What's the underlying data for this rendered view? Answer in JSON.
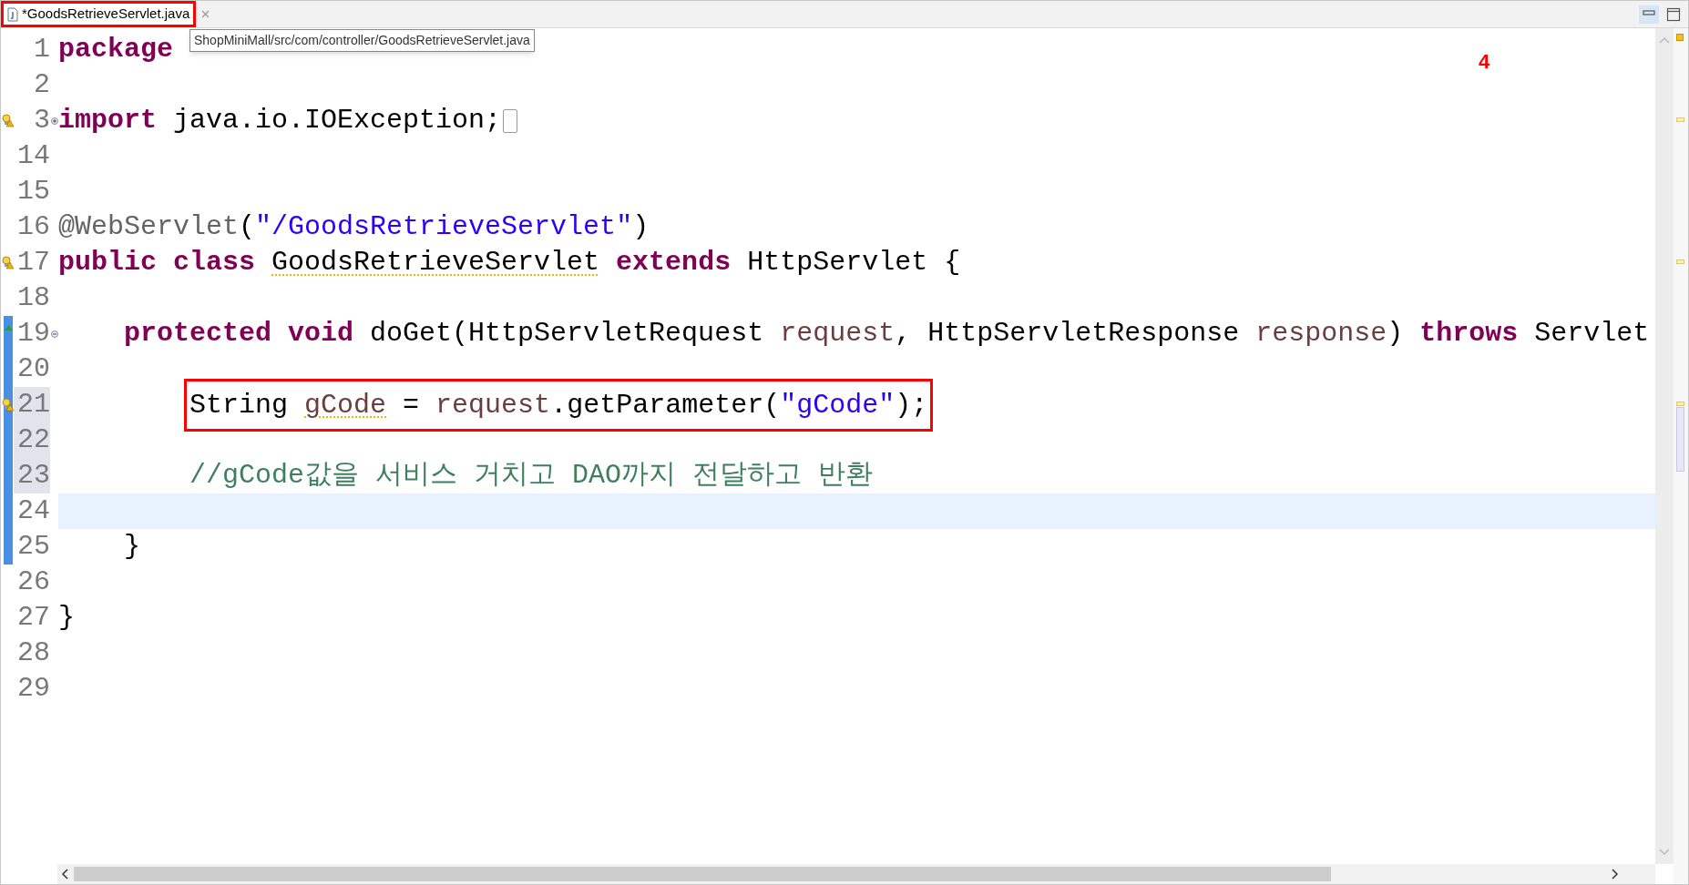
{
  "tab": {
    "title": "*GoodsRetrieveServlet.java",
    "selected": true,
    "boxed": true
  },
  "tooltip": "ShopMiniMall/src/com/controller/GoodsRetrieveServlet.java",
  "annotation": "4",
  "lines": [
    {
      "number": "1",
      "current": false,
      "in_range": false,
      "number_selected": false,
      "boxed": false,
      "warning": false,
      "tokens": [
        {
          "kind": "keyword",
          "text": "package"
        }
      ]
    },
    {
      "number": "2",
      "current": false,
      "in_range": false,
      "number_selected": false,
      "boxed": false,
      "warning": false
    },
    {
      "number": "3",
      "current": false,
      "in_range": false,
      "number_selected": false,
      "boxed": false,
      "warning": true,
      "collapsed": true,
      "tokens": [
        {
          "kind": "keyword",
          "text": "import"
        },
        {
          "kind": "plain",
          "text": " java.io.IOException;"
        }
      ]
    },
    {
      "number": "14",
      "current": false,
      "in_range": false,
      "number_selected": false,
      "boxed": false,
      "warning": false
    },
    {
      "number": "15",
      "current": false,
      "in_range": false,
      "number_selected": false,
      "boxed": false,
      "warning": false
    },
    {
      "number": "16",
      "current": false,
      "in_range": false,
      "number_selected": false,
      "boxed": false,
      "warning": false,
      "tokens": [
        {
          "kind": "annotation",
          "text": "@WebServlet"
        },
        {
          "kind": "plain",
          "text": "("
        },
        {
          "kind": "string",
          "text": "\"/GoodsRetrieveServlet\""
        },
        {
          "kind": "plain",
          "text": ")"
        }
      ]
    },
    {
      "number": "17",
      "current": false,
      "in_range": false,
      "number_selected": false,
      "boxed": false,
      "warning": true,
      "tokens": [
        {
          "kind": "keyword",
          "text": "public class "
        },
        {
          "kind": "plain",
          "text": "GoodsRetrieveServlet",
          "warning": true
        },
        {
          "kind": "keyword",
          "text": " extends"
        },
        {
          "kind": "plain",
          "text": " HttpServlet {"
        }
      ]
    },
    {
      "number": "18",
      "current": false,
      "in_range": false,
      "number_selected": false,
      "boxed": false,
      "warning": false
    },
    {
      "number": "19",
      "current": false,
      "in_range": true,
      "number_selected": false,
      "boxed": false,
      "warning": false,
      "collapsed": false,
      "tokens": [
        {
          "kind": "keyword",
          "text": "    protected void"
        },
        {
          "kind": "plain",
          "text": " doGet(HttpServletRequest "
        },
        {
          "kind": "variable",
          "text": "request"
        },
        {
          "kind": "plain",
          "text": ", HttpServletResponse "
        },
        {
          "kind": "variable",
          "text": "response"
        },
        {
          "kind": "plain",
          "text": ") "
        },
        {
          "kind": "keyword",
          "text": "throws"
        },
        {
          "kind": "plain",
          "text": " Servlet"
        }
      ]
    },
    {
      "number": "20",
      "current": false,
      "in_range": true,
      "number_selected": false,
      "boxed": false,
      "warning": false
    },
    {
      "number": "21",
      "current": false,
      "in_range": true,
      "number_selected": true,
      "boxed": true,
      "warning": true,
      "tokens": [
        {
          "kind": "plain",
          "text": "        String "
        },
        {
          "kind": "variable",
          "text": "gCode",
          "warning": true
        },
        {
          "kind": "plain",
          "text": " = "
        },
        {
          "kind": "variable",
          "text": "request"
        },
        {
          "kind": "plain",
          "text": ".getParameter("
        },
        {
          "kind": "string",
          "text": "\"gCode\""
        },
        {
          "kind": "plain",
          "text": ");"
        }
      ]
    },
    {
      "number": "22",
      "current": false,
      "in_range": true,
      "number_selected": true,
      "boxed": false,
      "warning": false
    },
    {
      "number": "23",
      "current": false,
      "in_range": true,
      "number_selected": true,
      "boxed": false,
      "warning": false,
      "tokens": [
        {
          "kind": "comment",
          "text": "        //gCode값을 서비스 거치고 DAO까지 전달하고 반환"
        }
      ]
    },
    {
      "number": "24",
      "current": true,
      "in_range": true,
      "number_selected": false,
      "boxed": false,
      "warning": false
    },
    {
      "number": "25",
      "current": false,
      "in_range": true,
      "number_selected": false,
      "boxed": false,
      "warning": false,
      "tokens": [
        {
          "kind": "plain",
          "text": "    }"
        }
      ]
    },
    {
      "number": "26",
      "current": false,
      "in_range": false,
      "number_selected": false,
      "boxed": false,
      "warning": false
    },
    {
      "number": "27",
      "current": false,
      "in_range": false,
      "number_selected": false,
      "boxed": false,
      "warning": false,
      "tokens": [
        {
          "kind": "plain",
          "text": "}"
        }
      ]
    },
    {
      "number": "28",
      "current": false,
      "in_range": false,
      "number_selected": false,
      "boxed": false,
      "warning": false
    },
    {
      "number": "29",
      "current": false,
      "in_range": false,
      "number_selected": false,
      "boxed": false,
      "warning": false
    }
  ]
}
